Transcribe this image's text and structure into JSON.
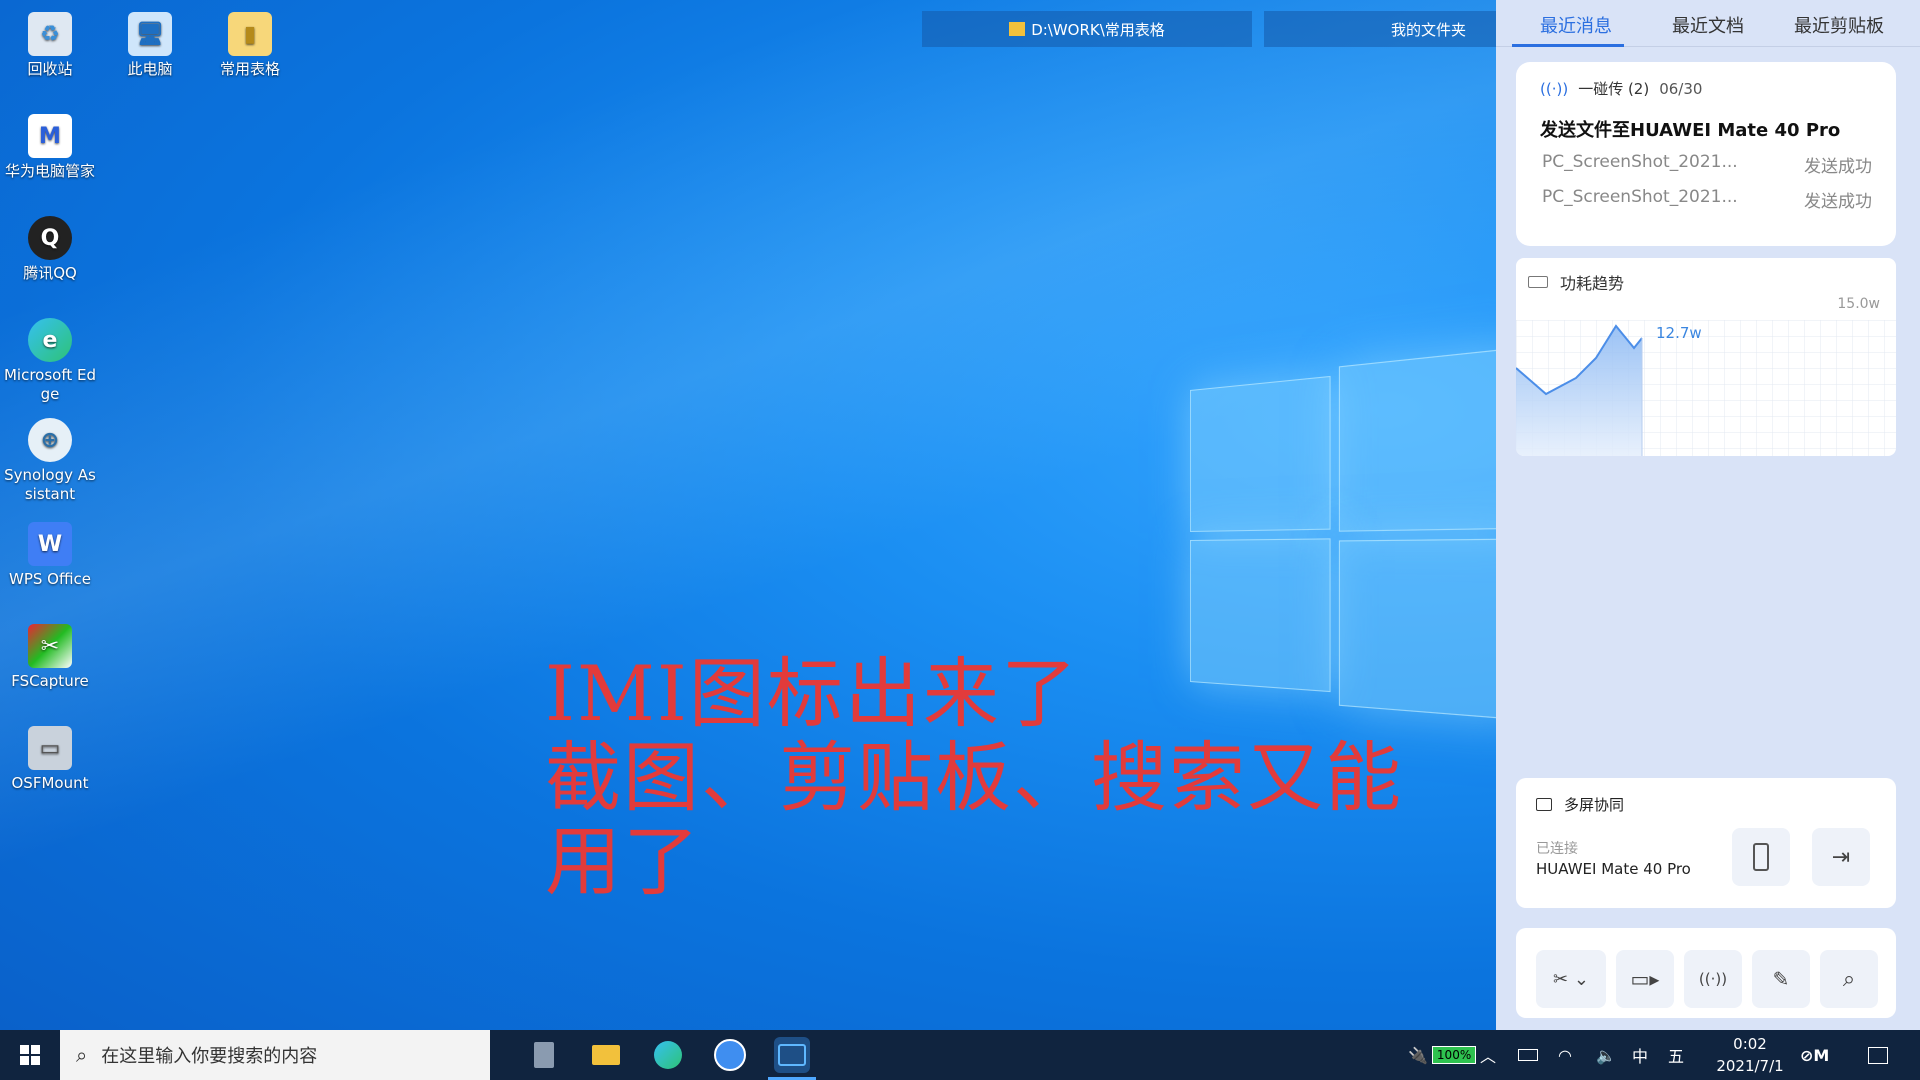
{
  "desktop_icons": [
    {
      "label": "回收站",
      "icon": "recycle-bin-icon"
    },
    {
      "label": "此电脑",
      "icon": "computer-icon"
    },
    {
      "label": "常用表格",
      "icon": "folder-icon"
    },
    {
      "label": "华为电脑管家",
      "icon": "huawei-pc-manager-icon"
    },
    {
      "label": "腾讯QQ",
      "icon": "qq-icon"
    },
    {
      "label": "Microsoft Ed\nge",
      "icon": "edge-icon"
    },
    {
      "label": "Synology As\nsistant",
      "icon": "synology-assistant-icon"
    },
    {
      "label": "WPS Office",
      "icon": "wps-icon"
    },
    {
      "label": "FSCapture",
      "icon": "fscapture-icon"
    },
    {
      "label": "OSFMount",
      "icon": "osfmount-icon"
    }
  ],
  "window_tabs": [
    "D:\\WORK\\常用表格",
    "我的文件夹"
  ],
  "overlay_text": [
    "IMI图标出来了",
    "截图、剪贴板、搜索又能",
    "用了"
  ],
  "panel": {
    "tabs": [
      "最近消息",
      "最近文档",
      "最近剪贴板"
    ],
    "message_card": {
      "source": "一碰传 (2)",
      "date": "06/30",
      "title": "发送文件至HUAWEI Mate 40 Pro",
      "files": [
        {
          "name": "PC_ScreenShot_2021...",
          "status": "发送成功"
        },
        {
          "name": "PC_ScreenShot_2021...",
          "status": "发送成功"
        }
      ]
    },
    "power_card": {
      "title": "功耗趋势",
      "max_label": "15.0w",
      "current_label": "12.7w"
    },
    "multiscreen": {
      "title": "多屏协同",
      "status": "已连接",
      "device": "HUAWEI Mate 40 Pro"
    },
    "tools": [
      "screenshot-icon",
      "screen-record-icon",
      "wireless-icon",
      "note-icon",
      "search-icon"
    ]
  },
  "taskbar": {
    "search_placeholder": "在这里输入你要搜索的内容",
    "battery": "100%",
    "ime_lang": "中",
    "ime_mode": "五",
    "time": "0:02",
    "date": "2021/7/1"
  }
}
